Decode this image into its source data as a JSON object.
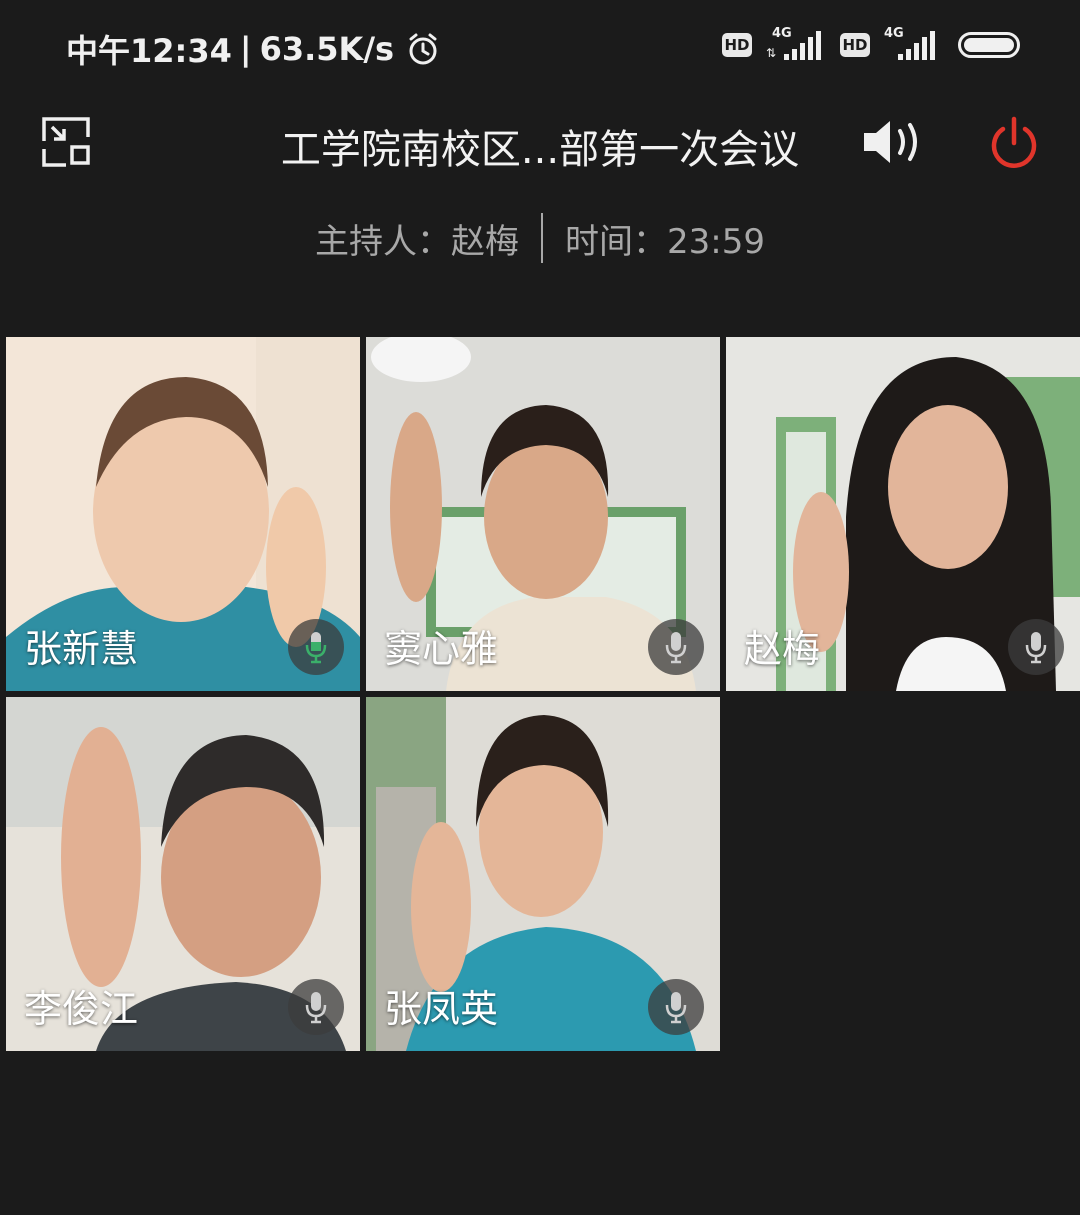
{
  "status_bar": {
    "time": "中午12:34",
    "separator": "|",
    "net_speed": "63.5K/s",
    "sim1_badge": "HD",
    "sim1_net": "4G",
    "sim2_badge": "HD",
    "sim2_net": "4G"
  },
  "header": {
    "title": "工学院南校区...部第一次会议",
    "host_label": "主持人：赵梅",
    "time_label": "时间：23:59"
  },
  "participants": [
    {
      "name": "张新慧",
      "mic": "active",
      "accent": "#3bb06a"
    },
    {
      "name": "窦心雅",
      "mic": "idle"
    },
    {
      "name": "赵梅",
      "mic": "idle"
    },
    {
      "name": "李俊江",
      "mic": "idle"
    },
    {
      "name": "张凤英",
      "mic": "idle"
    }
  ],
  "colors": {
    "background": "#1b1b1b",
    "power": "#e0352b",
    "mic_active": "#3bb06a",
    "text_muted": "#a8a8a8"
  },
  "icons": {
    "shrink": "shrink-window-icon",
    "speaker": "speaker-icon",
    "power": "power-icon",
    "alarm": "alarm-icon",
    "mic": "microphone-icon"
  }
}
